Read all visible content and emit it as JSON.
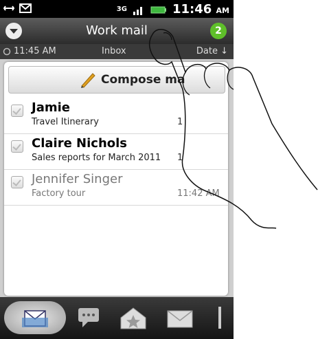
{
  "statusbar": {
    "network": "3G",
    "time": "11:46",
    "ampm": "AM"
  },
  "header": {
    "title": "Work mail",
    "badge": "2"
  },
  "subbar": {
    "sync_time": "11:45 AM",
    "folder": "Inbox",
    "sort": "Date"
  },
  "compose": {
    "label": "Compose ma"
  },
  "messages": [
    {
      "sender": "Jamie",
      "subject": "Travel Itinerary",
      "time": "1",
      "read": false
    },
    {
      "sender": "Claire Nichols",
      "subject": "Sales reports for March 2011",
      "time": "1",
      "read": false
    },
    {
      "sender": "Jennifer Singer",
      "subject": "Factory tour",
      "time": "11:42 AM",
      "read": true
    }
  ],
  "tabs": [
    {
      "name": "inbox-tab-icon"
    },
    {
      "name": "conversation-tab-icon"
    },
    {
      "name": "favorites-tab-icon"
    },
    {
      "name": "unread-tab-icon"
    },
    {
      "name": "flag-tab-icon"
    }
  ],
  "colors": {
    "badge": "#5fbf2a",
    "header": "#3a3a3a"
  }
}
